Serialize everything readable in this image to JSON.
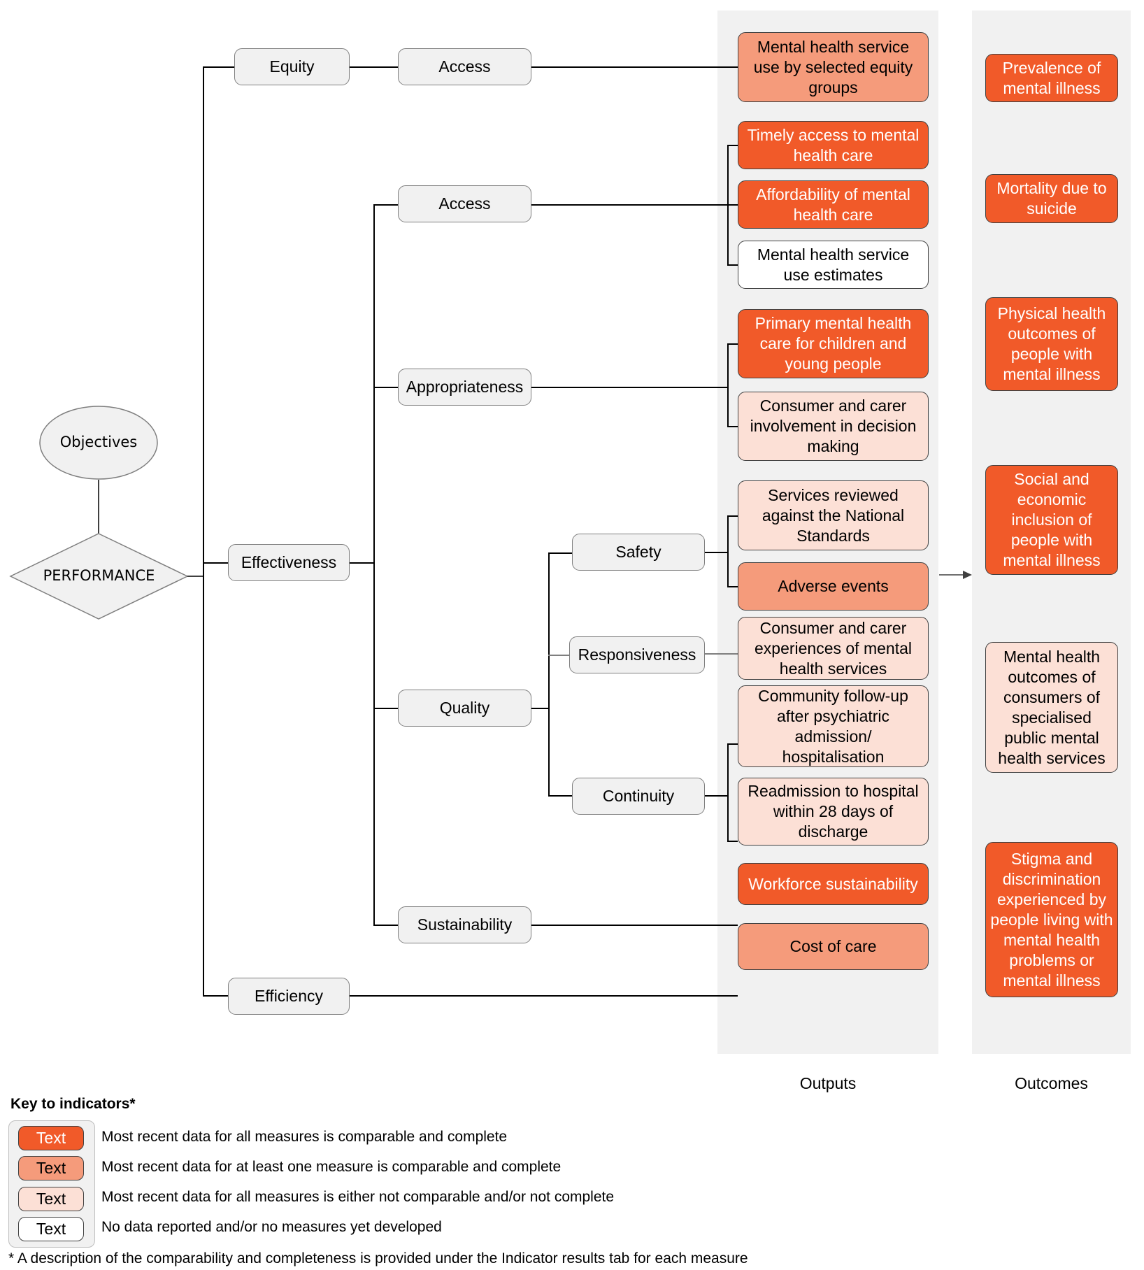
{
  "objectives": {
    "label": "Objectives"
  },
  "performance": {
    "label": "PERFORMANCE"
  },
  "level1": {
    "equity": "Equity",
    "effectiveness": "Effectiveness",
    "efficiency": "Efficiency"
  },
  "level2": {
    "equity_access": "Access",
    "access": "Access",
    "appropriateness": "Appropriateness",
    "quality": "Quality",
    "sustainability": "Sustainability"
  },
  "level3": {
    "safety": "Safety",
    "responsiveness": "Responsiveness",
    "continuity": "Continuity"
  },
  "outputs": {
    "heading": "Outputs",
    "items": [
      {
        "text": "Mental health service use by selected equity groups",
        "status": "partial"
      },
      {
        "text": "Timely access to mental health care",
        "status": "full"
      },
      {
        "text": "Affordability of mental health care",
        "status": "full"
      },
      {
        "text": "Mental health service use estimates",
        "status": "none"
      },
      {
        "text": "Primary mental health care for children and young people",
        "status": "full"
      },
      {
        "text": "Consumer and carer involvement in decision making",
        "status": "notcomp"
      },
      {
        "text": "Services reviewed against the National Standards",
        "status": "notcomp"
      },
      {
        "text": "Adverse events",
        "status": "partial"
      },
      {
        "text": "Consumer and carer experiences of mental health services",
        "status": "notcomp"
      },
      {
        "text": "Community follow-up after psychiatric admission/ hospitalisation",
        "status": "notcomp"
      },
      {
        "text": "Readmission to hospital within 28 days of discharge",
        "status": "notcomp"
      },
      {
        "text": "Workforce sustainability",
        "status": "full"
      },
      {
        "text": "Cost of care",
        "status": "partial"
      }
    ]
  },
  "outcomes": {
    "heading": "Outcomes",
    "items": [
      {
        "text": "Prevalence of mental illness",
        "status": "full"
      },
      {
        "text": "Mortality due to suicide",
        "status": "full"
      },
      {
        "text": "Physical health outcomes of people with mental illness",
        "status": "full"
      },
      {
        "text": "Social and economic inclusion of people with mental illness",
        "status": "full"
      },
      {
        "text": "Mental health outcomes of consumers of specialised public mental health services",
        "status": "notcomp"
      },
      {
        "text": "Stigma and discrimination experienced by people living with mental health problems or mental illness",
        "status": "full"
      }
    ]
  },
  "legend": {
    "title": "Key to indicators*",
    "items": [
      {
        "swatch": "Text",
        "status": "full",
        "description": "Most recent data for all measures is comparable and complete"
      },
      {
        "swatch": "Text",
        "status": "partial",
        "description": "Most recent data for at least one measure is comparable and complete"
      },
      {
        "swatch": "Text",
        "status": "notcomp",
        "description": "Most recent data for all measures is either not comparable and/or not complete"
      },
      {
        "swatch": "Text",
        "status": "none",
        "description": "No data reported and/or no measures yet developed"
      }
    ],
    "footnote": "* A description of the comparability and completeness is provided under the Indicator results tab for each measure"
  },
  "colors": {
    "full": "#F15A29",
    "partial": "#F59B7B",
    "notcomp": "#FCE0D6",
    "none": "#FFFFFF",
    "panel": "#F1F1F1"
  }
}
